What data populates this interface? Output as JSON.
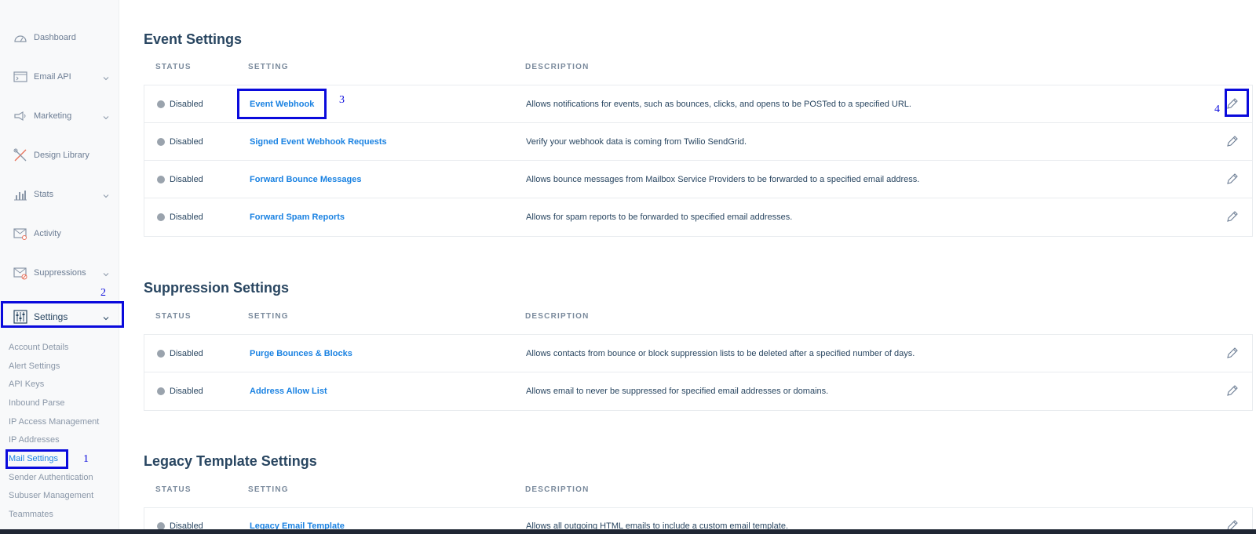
{
  "sidebar": {
    "items": [
      {
        "label": "Dashboard",
        "icon": "gauge-icon",
        "has_chevron": false
      },
      {
        "label": "Email API",
        "icon": "terminal-icon",
        "has_chevron": true
      },
      {
        "label": "Marketing",
        "icon": "megaphone-icon",
        "has_chevron": true
      },
      {
        "label": "Design Library",
        "icon": "design-tools-icon",
        "has_chevron": false
      },
      {
        "label": "Stats",
        "icon": "bar-chart-icon",
        "has_chevron": true
      },
      {
        "label": "Activity",
        "icon": "envelope-search-icon",
        "has_chevron": false
      },
      {
        "label": "Suppressions",
        "icon": "envelope-block-icon",
        "has_chevron": true
      },
      {
        "label": "Settings",
        "icon": "sliders-icon",
        "has_chevron": true,
        "active": true
      }
    ],
    "settings_subitems": [
      {
        "label": "Account Details"
      },
      {
        "label": "Alert Settings"
      },
      {
        "label": "API Keys"
      },
      {
        "label": "Inbound Parse"
      },
      {
        "label": "IP Access Management"
      },
      {
        "label": "IP Addresses"
      },
      {
        "label": "Mail Settings",
        "active": true
      },
      {
        "label": "Sender Authentication"
      },
      {
        "label": "Subuser Management"
      },
      {
        "label": "Teammates"
      }
    ]
  },
  "columns": {
    "status": "STATUS",
    "setting": "SETTING",
    "description": "DESCRIPTION"
  },
  "sections": [
    {
      "title": "Event Settings",
      "rows": [
        {
          "status": "Disabled",
          "setting": "Event Webhook",
          "description": "Allows notifications for events, such as bounces, clicks, and opens to be POSTed to a specified URL."
        },
        {
          "status": "Disabled",
          "setting": "Signed Event Webhook Requests",
          "description": "Verify your webhook data is coming from Twilio SendGrid."
        },
        {
          "status": "Disabled",
          "setting": "Forward Bounce Messages",
          "description": "Allows bounce messages from Mailbox Service Providers to be forwarded to a specified email address."
        },
        {
          "status": "Disabled",
          "setting": "Forward Spam Reports",
          "description": "Allows for spam reports to be forwarded to specified email addresses."
        }
      ]
    },
    {
      "title": "Suppression Settings",
      "rows": [
        {
          "status": "Disabled",
          "setting": "Purge Bounces & Blocks",
          "description": "Allows contacts from bounce or block suppression lists to be deleted after a specified number of days."
        },
        {
          "status": "Disabled",
          "setting": "Address Allow List",
          "description": "Allows email to never be suppressed for specified email addresses or domains."
        }
      ]
    },
    {
      "title": "Legacy Template Settings",
      "rows": [
        {
          "status": "Disabled",
          "setting": "Legacy Email Template",
          "description": "Allows all outgoing HTML emails to include a custom email template."
        }
      ]
    }
  ],
  "annotations": [
    "1",
    "2",
    "3",
    "4"
  ],
  "colors": {
    "link": "#1a82e2",
    "heading": "#294661",
    "annotation": "#0a0adc",
    "status_dot": "#9aa3ad"
  }
}
